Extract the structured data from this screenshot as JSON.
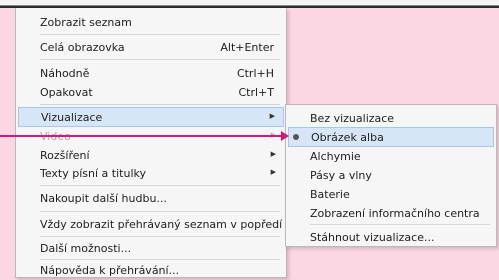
{
  "menu": {
    "items": [
      {
        "label": "Zobrazit seznam",
        "shortcut": ""
      },
      {
        "label": "Celá obrazovka",
        "shortcut": "Alt+Enter"
      },
      {
        "label": "Náhodně",
        "shortcut": "Ctrl+H"
      },
      {
        "label": "Opakovat",
        "shortcut": "Ctrl+T"
      },
      {
        "label": "Vizualizace",
        "shortcut": ""
      },
      {
        "label": "Video",
        "shortcut": ""
      },
      {
        "label": "Rozšíření",
        "shortcut": ""
      },
      {
        "label": "Texty písní a titulky",
        "shortcut": ""
      },
      {
        "label": "Nakoupit další hudbu...",
        "shortcut": ""
      },
      {
        "label": "Vždy zobrazit přehrávaný seznam v popředí",
        "shortcut": ""
      },
      {
        "label": "Další možnosti...",
        "shortcut": ""
      },
      {
        "label": "Nápověda k přehrávání...",
        "shortcut": ""
      }
    ]
  },
  "submenu": {
    "items": [
      {
        "label": "Bez vizualizace"
      },
      {
        "label": "Obrázek alba"
      },
      {
        "label": "Alchymie"
      },
      {
        "label": "Pásy a vlny"
      },
      {
        "label": "Baterie"
      },
      {
        "label": "Zobrazení informačního centra"
      },
      {
        "label": "Stáhnout vizualizace..."
      }
    ]
  },
  "colors": {
    "background": "#fbd6e3",
    "highlight": "#d7e6f7",
    "pointer": "#d01a7b"
  }
}
